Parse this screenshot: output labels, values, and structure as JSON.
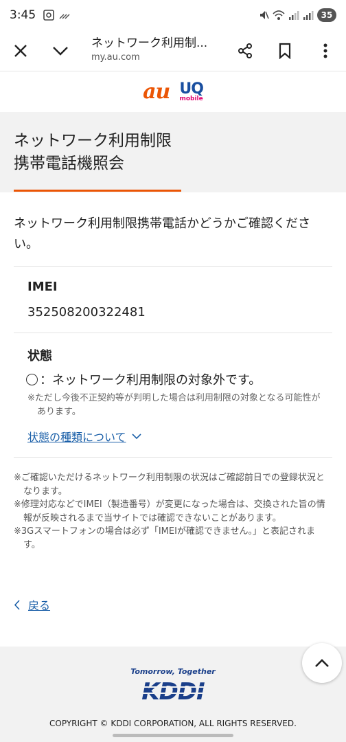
{
  "status_bar": {
    "time": "3:45",
    "battery": "35"
  },
  "browser": {
    "page_title": "ネットワーク利用制...",
    "url": "my.au.com"
  },
  "logos": {
    "au": "au",
    "uq_main": "UQ",
    "uq_sub": "mobile"
  },
  "heading": {
    "line1": "ネットワーク利用制限",
    "line2": "携帯電話機照会"
  },
  "intro": "ネットワーク利用制限携帯電話かどうかご確認ください。",
  "imei": {
    "label": "IMEI",
    "value": "352508200322481"
  },
  "state": {
    "label": "状態",
    "value": "：ネットワーク利用制限の対象外です。",
    "note": "※ただし今後不正契約等が判明した場合は利用制限の対象となる可能性があります。",
    "link": "状態の種類について"
  },
  "notes": [
    "※ご確認いただけるネットワーク利用制限の状況はご確認前日での登録状況となります。",
    "※修理対応などでIMEI（製造番号）が変更になった場合は、交換された旨の情報が反映されるまで当サイトでは確認できないことがあります。",
    "※3Gスマートフォンの場合は必ず「IMEIが確認できません。」と表記されます。"
  ],
  "back": "戻る",
  "footer": {
    "tagline": "Tomorrow, Together",
    "logo": "KDDI",
    "copyright": "COPYRIGHT © KDDI CORPORATION, ALL RIGHTS RESERVED."
  },
  "colors": {
    "accent_orange": "#eb5505",
    "link_blue": "#1a5fa8",
    "kddi_blue": "#1a3f8a"
  }
}
